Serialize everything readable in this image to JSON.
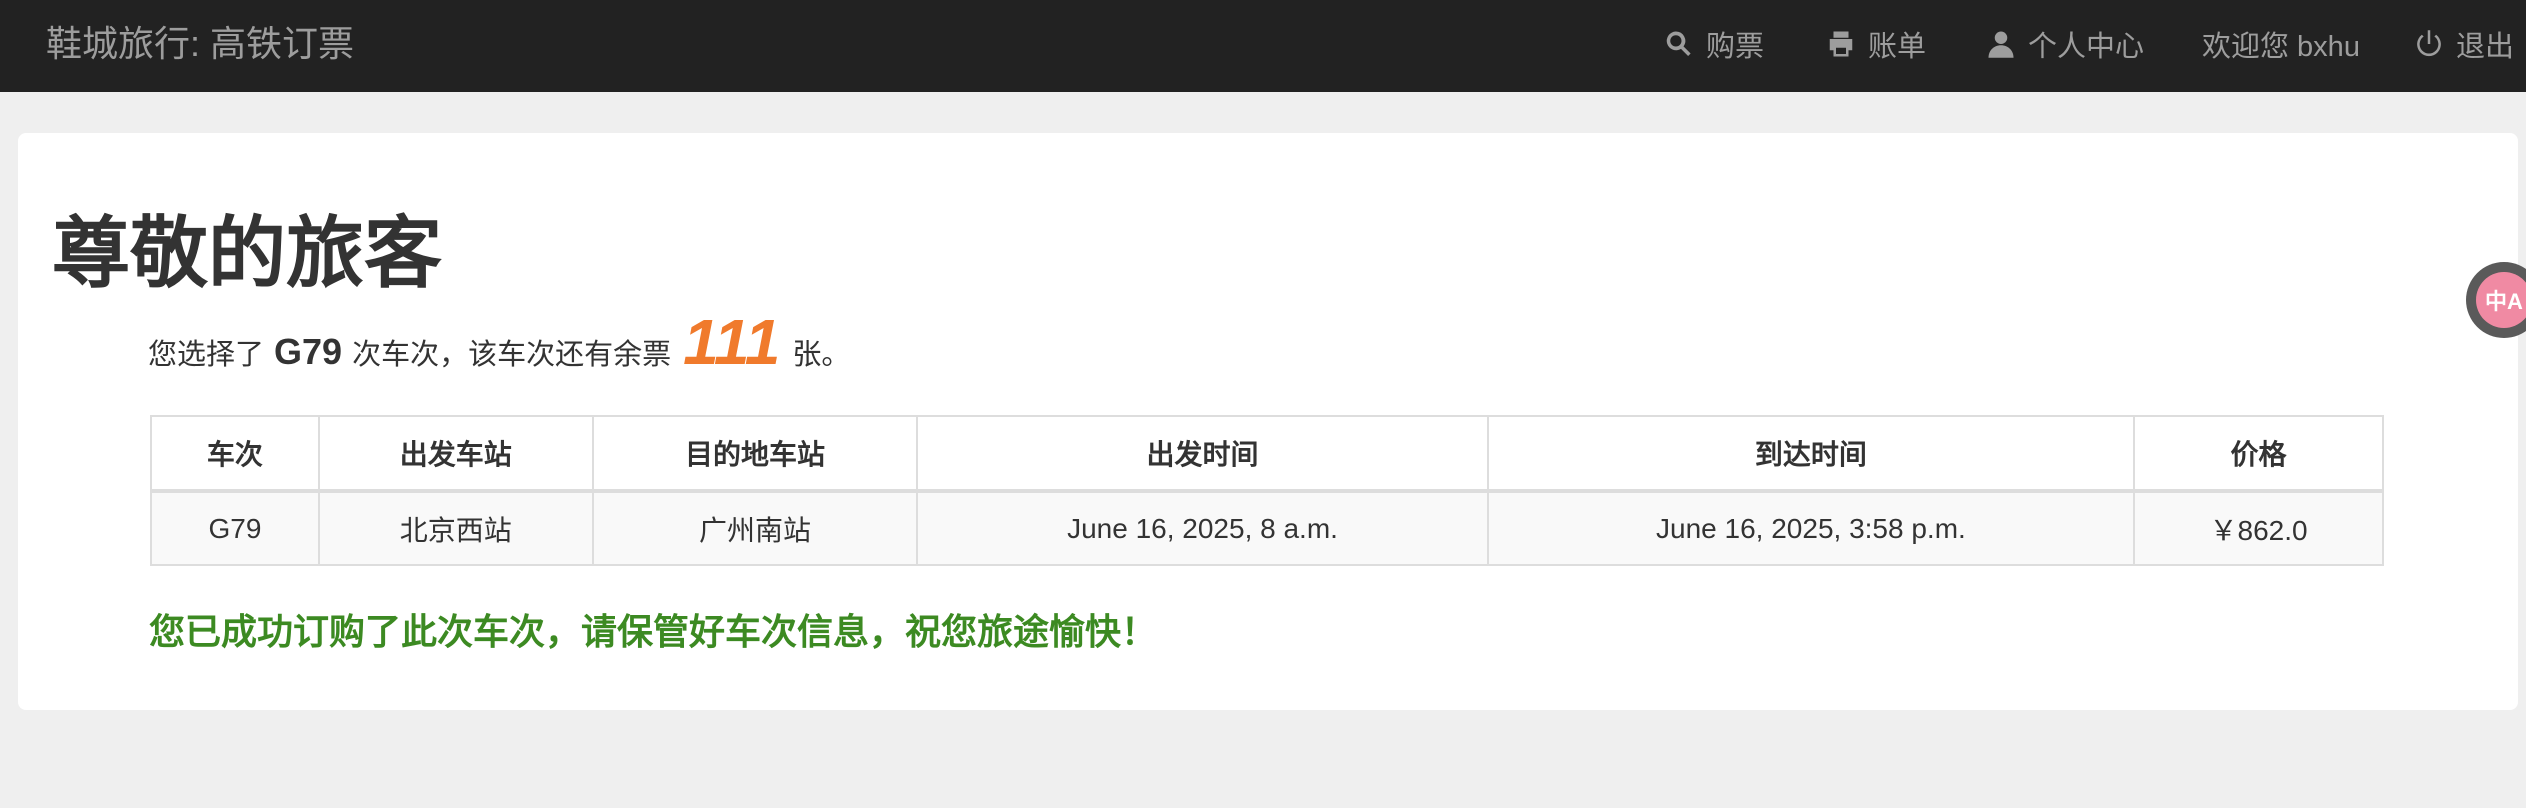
{
  "navbar": {
    "brand": "鞋城旅行: 高铁订票",
    "items": [
      {
        "label": "购票",
        "icon": "search-icon"
      },
      {
        "label": "账单",
        "icon": "print-icon"
      },
      {
        "label": "个人中心",
        "icon": "user-icon"
      },
      {
        "label": "欢迎您 bxhu",
        "icon": ""
      },
      {
        "label": "退出",
        "icon": "power-icon"
      }
    ]
  },
  "main": {
    "title": "尊敬的旅客",
    "info": {
      "prefix": "您选择了",
      "train_no": "G79",
      "middle": "次车次，该车次还有余票",
      "remaining": "111",
      "suffix": "张。"
    },
    "table": {
      "headers": [
        "车次",
        "出发车站",
        "目的地车站",
        "出发时间",
        "到达时间",
        "价格"
      ],
      "rows": [
        [
          "G79",
          "北京西站",
          "广州南站",
          "June 16, 2025, 8 a.m.",
          "June 16, 2025, 3:58 p.m.",
          "￥862.0"
        ]
      ]
    },
    "success_message": "您已成功订购了此次车次，请保管好车次信息，祝您旅途愉快！"
  },
  "translate_button": {
    "label": "中A",
    "icon": "translate-icon"
  },
  "colors": {
    "navbar_bg": "#222222",
    "accent_orange": "#f07a2c",
    "success_green": "#3c8a22"
  }
}
